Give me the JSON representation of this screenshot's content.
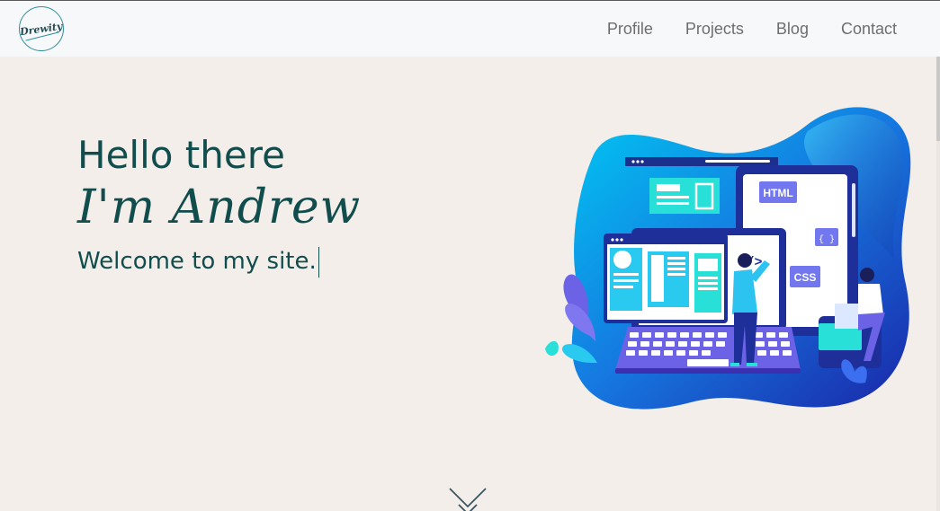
{
  "header": {
    "logo_text": "Drewity",
    "nav": [
      {
        "label": "Profile"
      },
      {
        "label": "Projects"
      },
      {
        "label": "Blog"
      },
      {
        "label": "Contact"
      }
    ]
  },
  "hero": {
    "greeting": "Hello there",
    "name": "I'm Andrew",
    "welcome": "Welcome to my site."
  },
  "illustration": {
    "tags": {
      "html": "HTML",
      "braces": "{ }",
      "css": "CSS",
      "code": "</>"
    }
  },
  "colors": {
    "background": "#f3eee9",
    "navbar": "#f7f8f9",
    "heading": "#114d4d",
    "nav_text": "#6e6e6e",
    "blob_light": "#00c3f0",
    "blob_dark": "#1c2fb8"
  },
  "icons": {
    "scroll_down": "chevron-down-icon"
  }
}
